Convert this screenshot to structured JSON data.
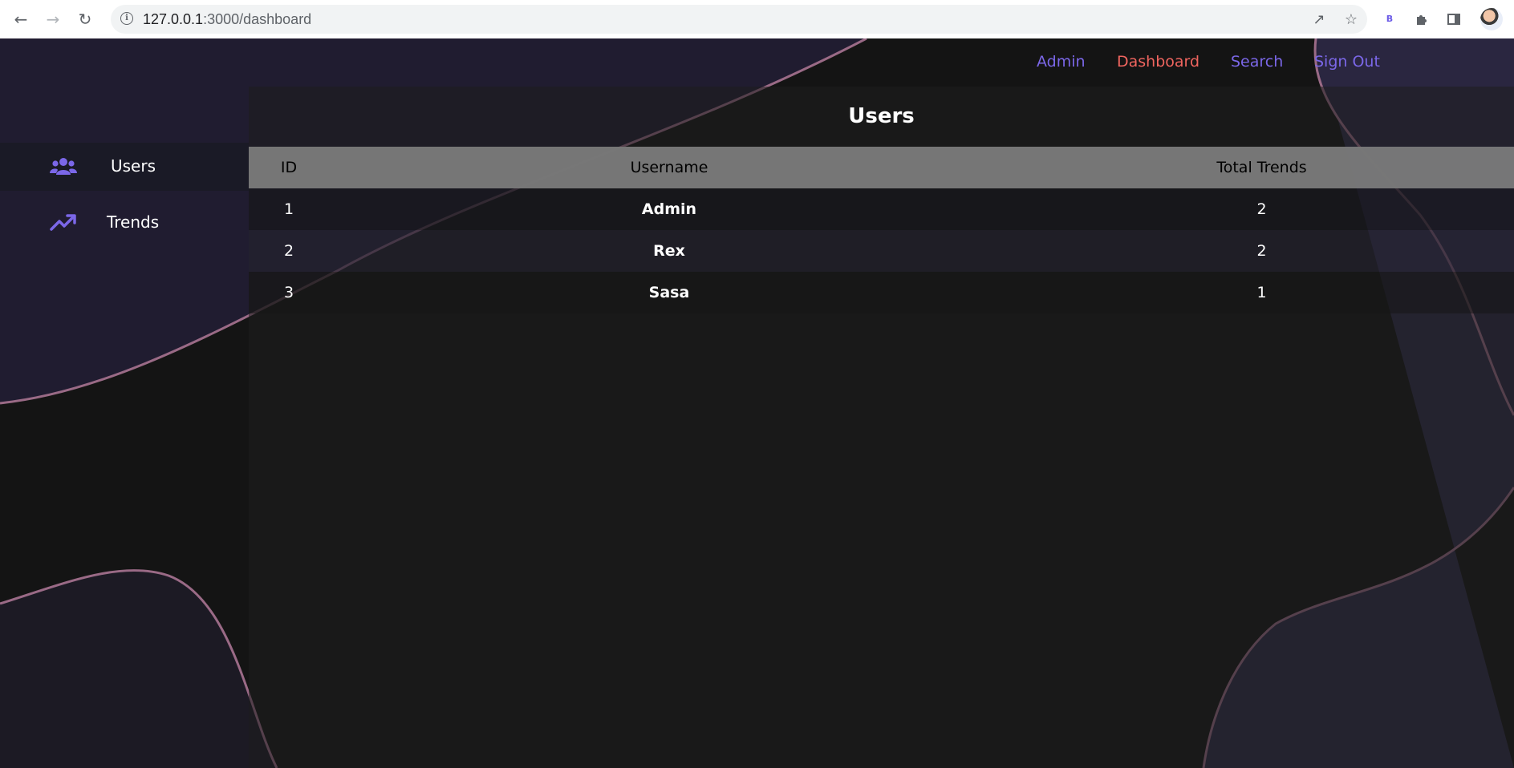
{
  "browser": {
    "url_host": "127.0.0.1",
    "url_path": ":3000/dashboard",
    "icons": [
      "back-arrow-icon",
      "forward-arrow-icon",
      "reload-icon",
      "site-info-icon",
      "share-icon",
      "bookmark-star-icon",
      "bing-extension-icon",
      "extensions-puzzle-icon",
      "side-panel-icon",
      "profile-avatar"
    ],
    "bing_label": "B"
  },
  "topnav": {
    "admin": "Admin",
    "dashboard": "Dashboard",
    "search": "Search",
    "sign_out": "Sign Out",
    "active": "Dashboard"
  },
  "sidebar": {
    "items": [
      {
        "label": "Users",
        "icon": "users-icon",
        "selected": true
      },
      {
        "label": "Trends",
        "icon": "trending-up-icon",
        "selected": false
      }
    ]
  },
  "main": {
    "title": "Users",
    "table": {
      "headers": [
        "ID",
        "Username",
        "Total Trends"
      ],
      "rows": [
        {
          "id": "1",
          "username": "Admin",
          "total_trends": "2"
        },
        {
          "id": "2",
          "username": "Rex",
          "total_trends": "2"
        },
        {
          "id": "3",
          "username": "Sasa",
          "total_trends": "1"
        }
      ]
    }
  },
  "colors": {
    "accent": "#7b67e8",
    "active_link": "#f0655f",
    "background": "#141414",
    "purple_blob": "#2e2a45",
    "curve_stroke": "#9a6a86"
  }
}
